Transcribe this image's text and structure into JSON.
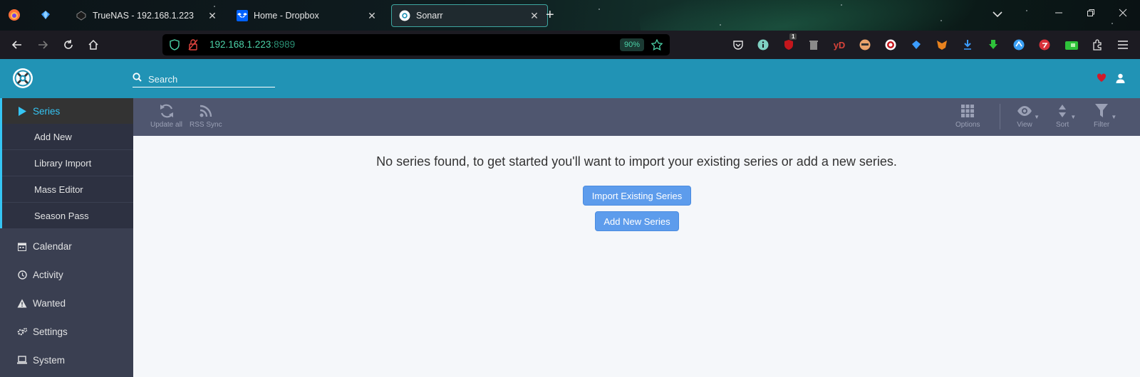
{
  "browser": {
    "tabs": [
      {
        "title": "TrueNAS - 192.168.1.223",
        "active": false
      },
      {
        "title": "Home - Dropbox",
        "active": false
      },
      {
        "title": "Sonarr",
        "active": true
      }
    ],
    "url_host": "192.168.1.223",
    "url_port": ":8989",
    "zoom": "90%",
    "extension_badge": "1",
    "extension_text": "yD"
  },
  "header": {
    "search_placeholder": "Search"
  },
  "sidebar": {
    "items": [
      {
        "label": "Series",
        "icon": "play-icon",
        "active": true
      },
      {
        "label": "Calendar",
        "icon": "calendar-icon"
      },
      {
        "label": "Activity",
        "icon": "clock-icon"
      },
      {
        "label": "Wanted",
        "icon": "warning-icon"
      },
      {
        "label": "Settings",
        "icon": "gears-icon"
      },
      {
        "label": "System",
        "icon": "laptop-icon"
      }
    ],
    "sub_items": [
      "Add New",
      "Library Import",
      "Mass Editor",
      "Season Pass"
    ]
  },
  "toolbar": {
    "update_all": "Update all",
    "rss_sync": "RSS Sync",
    "options": "Options",
    "view": "View",
    "sort": "Sort",
    "filter": "Filter"
  },
  "main": {
    "empty_message": "No series found, to get started you'll want to import your existing series or add a new series.",
    "import_button": "Import Existing Series",
    "add_button": "Add New Series"
  },
  "colors": {
    "header": "#2193b5",
    "sidebar": "#3a3f51",
    "toolbar": "#4f566f",
    "accent": "#35c5f4",
    "button": "#5d9cec"
  }
}
